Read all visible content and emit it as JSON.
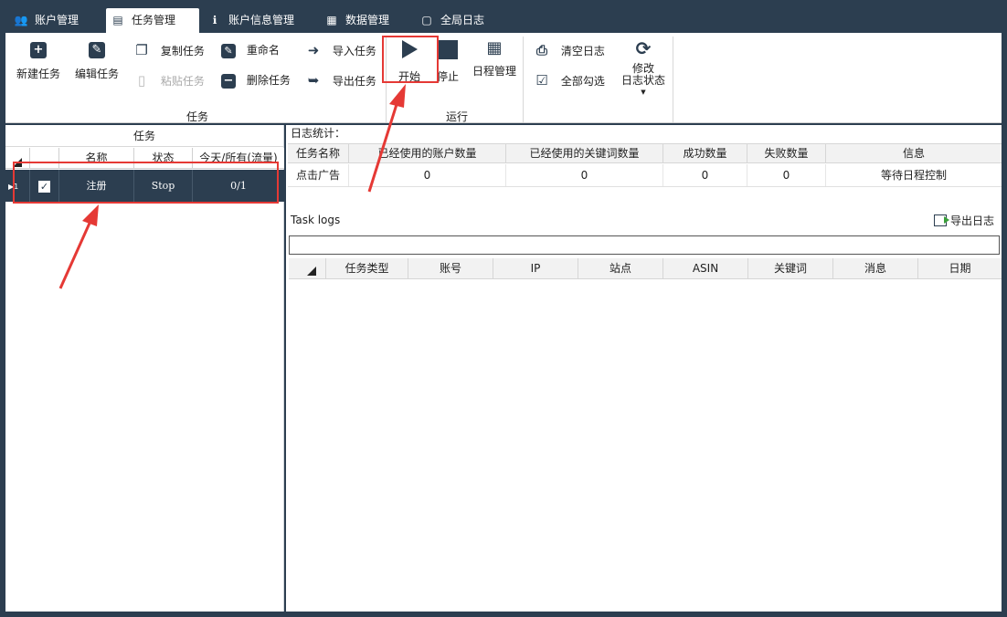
{
  "tabs": [
    {
      "icon": "users-icon",
      "glyph": "👥",
      "label": "账户管理"
    },
    {
      "icon": "list-icon",
      "glyph": "▤",
      "label": "任务管理"
    },
    {
      "icon": "info-icon",
      "glyph": "ℹ",
      "label": "账户信息管理"
    },
    {
      "icon": "grid-icon",
      "glyph": "▦",
      "label": "数据管理"
    },
    {
      "icon": "document-icon",
      "glyph": "▢",
      "label": "全局日志"
    }
  ],
  "active_tab": "任务管理",
  "ribbon": {
    "new_task": "新建任务",
    "edit_task": "编辑任务",
    "copy_task": "复制任务",
    "paste_task": "粘贴任务",
    "rename": "重命名",
    "delete_task": "删除任务",
    "import_task": "导入任务",
    "export_task": "导出任务",
    "group_task": "任务",
    "start": "开始",
    "stop": "停止",
    "schedule": "日程管理",
    "group_run": "运行",
    "clear_log": "清空日志",
    "select_all": "全部勾选",
    "modify_log_status_1": "修改",
    "modify_log_status_2": "日志状态"
  },
  "left_panel": {
    "title": "任务",
    "columns": [
      "名称",
      "状态",
      "今天/所有(流量)"
    ],
    "rows": [
      {
        "index": "1",
        "checked": true,
        "name": "注册",
        "status": "Stop",
        "count": "0/1"
      }
    ]
  },
  "log_stats": {
    "title": "日志统计：",
    "columns": [
      "任务名称",
      "已经使用的账户数量",
      "已经使用的关键词数量",
      "成功数量",
      "失败数量",
      "信息"
    ],
    "rows": [
      [
        "点击广告",
        "0",
        "0",
        "0",
        "0",
        "等待日程控制"
      ]
    ]
  },
  "task_logs": {
    "title": "Task logs",
    "export_label": "导出日志",
    "filter_value": "",
    "columns": [
      "任务类型",
      "账号",
      "IP",
      "站点",
      "ASIN",
      "关键词",
      "消息",
      "日期"
    ]
  },
  "colors": {
    "chrome": "#2c3e50",
    "annotation": "#e53935"
  }
}
